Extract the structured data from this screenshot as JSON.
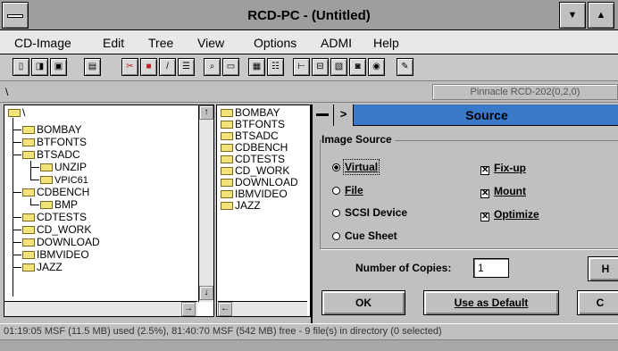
{
  "window": {
    "title": "RCD-PC - (Untitled)",
    "scroll_down": "▼",
    "scroll_up": "▲"
  },
  "menu": [
    "CD-Image",
    "Edit",
    "Tree",
    "View",
    "Options",
    "ADMI",
    "Help"
  ],
  "path": {
    "current": "\\",
    "device": "Pinnacle RCD-202(0,2,0)"
  },
  "tree": {
    "root": "\\",
    "items": [
      "BOMBAY",
      "BTFONTS",
      "BTSADC",
      "UNZIP",
      "VPIC61",
      "CDBENCH",
      "BMP",
      "CDTESTS",
      "CD_WORK",
      "DOWNLOAD",
      "IBMVIDEO",
      "JAZZ"
    ]
  },
  "scroll": {
    "up": "↑",
    "down": "↓",
    "right": "→",
    "left": "←"
  },
  "files": [
    "BOMBAY",
    "BTFONTS",
    "BTSADC",
    "CDBENCH",
    "CDTESTS",
    "CD_WORK",
    "DOWNLOAD",
    "IBMVIDEO",
    "JAZZ"
  ],
  "dialog": {
    "title": "Source",
    "group_label": "Image Source",
    "radios": [
      {
        "label": "Virtual",
        "checked": true
      },
      {
        "label": "File",
        "checked": false
      },
      {
        "label": "SCSI Device",
        "checked": false
      },
      {
        "label": "Cue Sheet",
        "checked": false
      }
    ],
    "checks": [
      {
        "label": "Fix-up",
        "checked": true
      },
      {
        "label": "Mount",
        "checked": true
      },
      {
        "label": "Optimize",
        "checked": true
      }
    ],
    "copies_label": "Number of Copies:",
    "copies_value": "1",
    "ok_label": "OK",
    "default_label": "Use as Default",
    "cancel_label": "C",
    "help_label": "H"
  },
  "status": "01:19:05 MSF (11.5 MB) used (2.5%), 81:40:70 MSF (542 MB) free - 9 file(s) in directory (0 selected)"
}
